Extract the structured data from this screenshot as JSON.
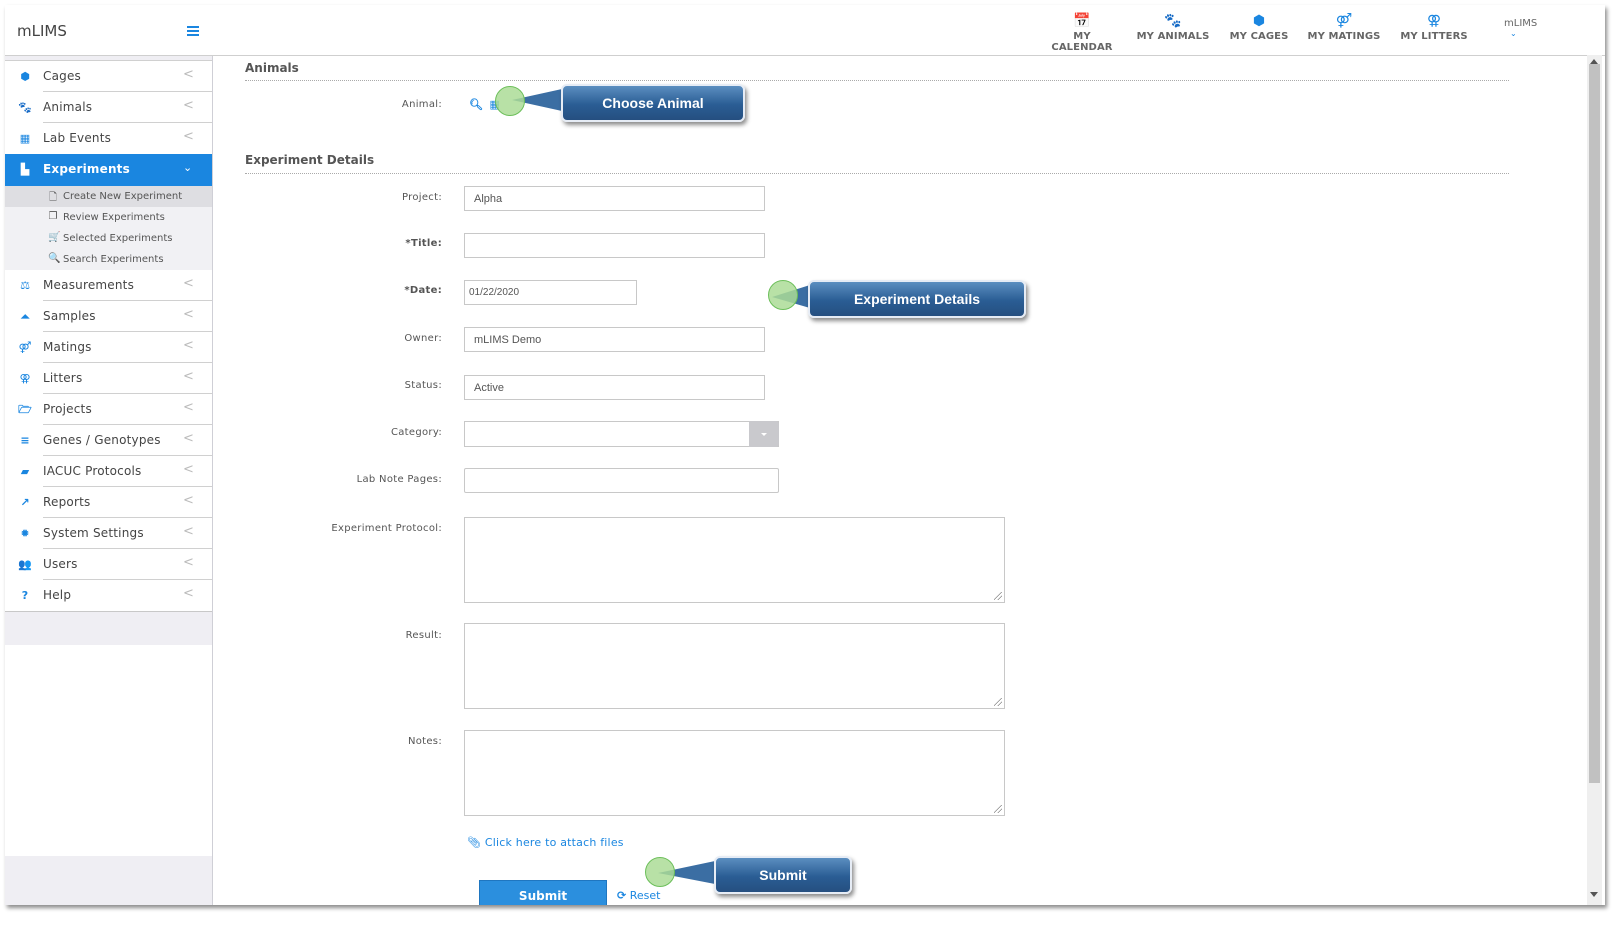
{
  "app": {
    "brand": "mLIMS"
  },
  "sidebar": {
    "items": [
      {
        "label": "Cages",
        "icon": "cube-icon",
        "glyph": "⬢"
      },
      {
        "label": "Animals",
        "icon": "paw-icon",
        "glyph": "🐾"
      },
      {
        "label": "Lab Events",
        "icon": "calendar-icon",
        "glyph": "▦"
      },
      {
        "label": "Experiments",
        "icon": "experiment-icon",
        "glyph": "▙",
        "active": true
      },
      {
        "label": "Measurements",
        "icon": "balance-scale-icon",
        "glyph": "⚖"
      },
      {
        "label": "Samples",
        "icon": "flask-icon",
        "glyph": "⏶"
      },
      {
        "label": "Matings",
        "icon": "mars-venus-icon",
        "glyph": "⚤"
      },
      {
        "label": "Litters",
        "icon": "venus-double-icon",
        "glyph": "⚢"
      },
      {
        "label": "Projects",
        "icon": "folder-open-icon",
        "glyph": "🗁"
      },
      {
        "label": "Genes / Genotypes",
        "icon": "list-icon",
        "glyph": "≡"
      },
      {
        "label": "IACUC Protocols",
        "icon": "book-icon",
        "glyph": "▰"
      },
      {
        "label": "Reports",
        "icon": "line-chart-icon",
        "glyph": "↗"
      },
      {
        "label": "System Settings",
        "icon": "gear-icon",
        "glyph": "✹"
      },
      {
        "label": "Users",
        "icon": "users-icon",
        "glyph": "👥"
      },
      {
        "label": "Help",
        "icon": "question-icon",
        "glyph": "?"
      }
    ],
    "experiments_sub": [
      {
        "label": "Create New Experiment",
        "icon": "file-icon",
        "glyph": "🗋",
        "current": true
      },
      {
        "label": "Review Experiments",
        "icon": "copy-icon",
        "glyph": "❐"
      },
      {
        "label": "Selected Experiments",
        "icon": "cart-icon",
        "glyph": "🛒"
      },
      {
        "label": "Search Experiments",
        "icon": "search-icon",
        "glyph": "🔍"
      }
    ]
  },
  "topbar": {
    "links": [
      {
        "label": "MY CALENDAR",
        "icon": "calendar-icon",
        "glyph": "📅"
      },
      {
        "label": "MY ANIMALS",
        "icon": "paw-icon",
        "glyph": "🐾"
      },
      {
        "label": "MY CAGES",
        "icon": "cube-icon",
        "glyph": "⬢"
      },
      {
        "label": "MY MATINGS",
        "icon": "mars-venus-icon",
        "glyph": "⚤"
      },
      {
        "label": "MY LITTERS",
        "icon": "venus-double-icon",
        "glyph": "⚢"
      }
    ],
    "user": "mLIMS",
    "user_chevron": "⌄"
  },
  "form": {
    "animals_section": "Animals",
    "animal_label": "Animal:",
    "details_section": "Experiment Details",
    "fields": {
      "project": {
        "label": "Project:",
        "value": "Alpha"
      },
      "title": {
        "label": "*Title:",
        "value": ""
      },
      "date": {
        "label": "*Date:",
        "value": "01/22/2020"
      },
      "owner": {
        "label": "Owner:",
        "value": "mLIMS Demo"
      },
      "status": {
        "label": "Status:",
        "value": "Active"
      },
      "category": {
        "label": "Category:",
        "value": ""
      },
      "lab_note_pages": {
        "label": "Lab Note Pages:",
        "value": ""
      },
      "experiment_protocol": {
        "label": "Experiment Protocol:",
        "value": ""
      },
      "result": {
        "label": "Result:",
        "value": ""
      },
      "notes": {
        "label": "Notes:",
        "value": ""
      }
    },
    "attach_label": "Click here to attach files",
    "submit_label": "Submit",
    "reset_label": "Reset"
  },
  "callouts": {
    "choose_animal": "Choose Animal",
    "experiment_details": "Experiment Details",
    "submit": "Submit"
  },
  "colors": {
    "accent": "#1a86e0",
    "callout": "#2a5d94",
    "marker": "#abdc96"
  }
}
